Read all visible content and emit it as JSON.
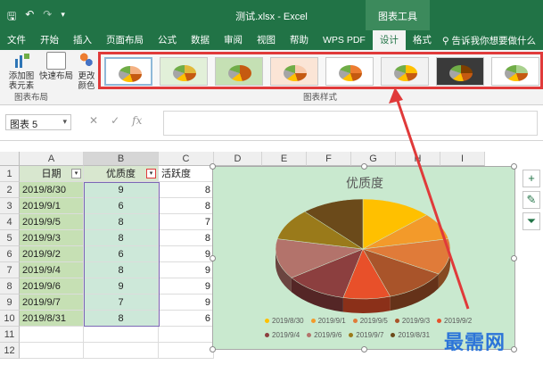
{
  "title_bar": {
    "doc_title": "测试.xlsx - Excel",
    "context_tab_group": "图表工具"
  },
  "tabs": [
    "文件",
    "开始",
    "插入",
    "页面布局",
    "公式",
    "数据",
    "审阅",
    "视图",
    "帮助",
    "WPS PDF",
    "设计",
    "格式"
  ],
  "active_tab": "设计",
  "tell_me": "告诉我你想要做什么",
  "ribbon": {
    "add_chart_element": "添加图表元素",
    "quick_layout": "快速布局",
    "change_colors": "更改颜色",
    "group_chart_layout": "图表布局",
    "group_chart_styles": "图表样式",
    "styles": [
      {
        "accent": "#f4b183"
      },
      {
        "accent": "#e2b93b"
      },
      {
        "accent": "#c55a11"
      },
      {
        "accent": "#f8cbad"
      },
      {
        "accent": "#ed7d31"
      },
      {
        "accent": "#ffc000"
      },
      {
        "accent": "#7f3f00"
      },
      {
        "accent": "#a9d18e"
      }
    ]
  },
  "formula_bar": {
    "name_box": "图表 5",
    "cancel": "✕",
    "enter": "✓",
    "fx": "fx"
  },
  "columns": [
    "A",
    "B",
    "C",
    "D",
    "E",
    "F",
    "G",
    "H",
    "I"
  ],
  "rows": [
    "1",
    "2",
    "3",
    "4",
    "5",
    "6",
    "7",
    "8",
    "9",
    "10",
    "11",
    "12"
  ],
  "table": {
    "headers": [
      "日期",
      "优质度",
      "活跃度"
    ],
    "rows": [
      [
        "2019/8/30",
        "9",
        "8"
      ],
      [
        "2019/9/1",
        "6",
        "8"
      ],
      [
        "2019/9/5",
        "8",
        "7"
      ],
      [
        "2019/9/3",
        "8",
        "8"
      ],
      [
        "2019/9/2",
        "6",
        "9"
      ],
      [
        "2019/9/4",
        "8",
        "9"
      ],
      [
        "2019/9/6",
        "9",
        "9"
      ],
      [
        "2019/9/7",
        "7",
        "9"
      ],
      [
        "2019/8/31",
        "8",
        "6"
      ]
    ]
  },
  "chart_data": {
    "type": "pie",
    "title": "优质度",
    "categories": [
      "2019/8/30",
      "2019/9/1",
      "2019/9/5",
      "2019/9/3",
      "2019/9/2",
      "2019/9/4",
      "2019/9/6",
      "2019/9/7",
      "2019/8/31"
    ],
    "values": [
      9,
      6,
      8,
      8,
      6,
      8,
      9,
      7,
      8
    ],
    "colors": [
      "#ffc000",
      "#f39a2a",
      "#e07b39",
      "#a9542a",
      "#e8502a",
      "#8c3f3f",
      "#b3736b",
      "#9a7a1a",
      "#6b4a1a"
    ],
    "legend_position": "bottom"
  },
  "watermark": "最需网"
}
